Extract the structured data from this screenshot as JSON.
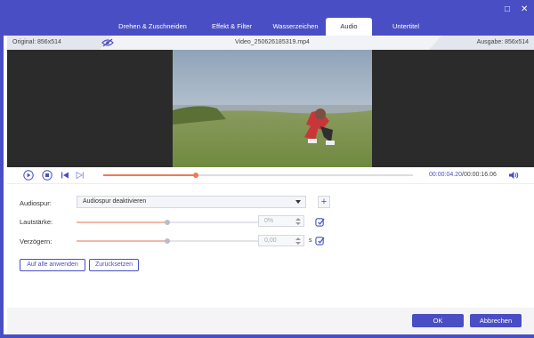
{
  "window": {
    "minimize_glyph": "□",
    "close_glyph": "✕"
  },
  "tabs": [
    {
      "label": "Drehen & Zuschneiden",
      "active": false
    },
    {
      "label": "Effekt & Filter",
      "active": false
    },
    {
      "label": "Wasserzeichen",
      "active": false
    },
    {
      "label": "Audio",
      "active": true
    },
    {
      "label": "Untertitel",
      "active": false
    }
  ],
  "infobar": {
    "original": "Original: 856x514",
    "filename": "Video_250626185319.mp4",
    "output": "Ausgabe: 856x514",
    "eye_icon": "eye-hidden-icon"
  },
  "player": {
    "current_time": "00:00:04.20",
    "separator": "/",
    "total_time": "00:00:16.06",
    "progress": 0.3,
    "icons": [
      "play-icon",
      "stop-icon",
      "skip-back-icon",
      "skip-forward-icon",
      "volume-icon"
    ]
  },
  "audio": {
    "track_label": "Audiospur:",
    "track_value": "Audiospur deaktivieren",
    "volume_label": "Lautstärke:",
    "volume_value": "0%",
    "volume_level": 0.5,
    "delay_label": "Verzögern:",
    "delay_value": "0,00",
    "delay_level": 0.5,
    "delay_unit": "s",
    "apply_all": "Auf alle anwenden",
    "reset": "Zurücksetzen"
  },
  "footer": {
    "ok": "OK",
    "cancel": "Abbrechen"
  },
  "colors": {
    "accent": "#4a4ec4",
    "progress": "#f07a54"
  }
}
